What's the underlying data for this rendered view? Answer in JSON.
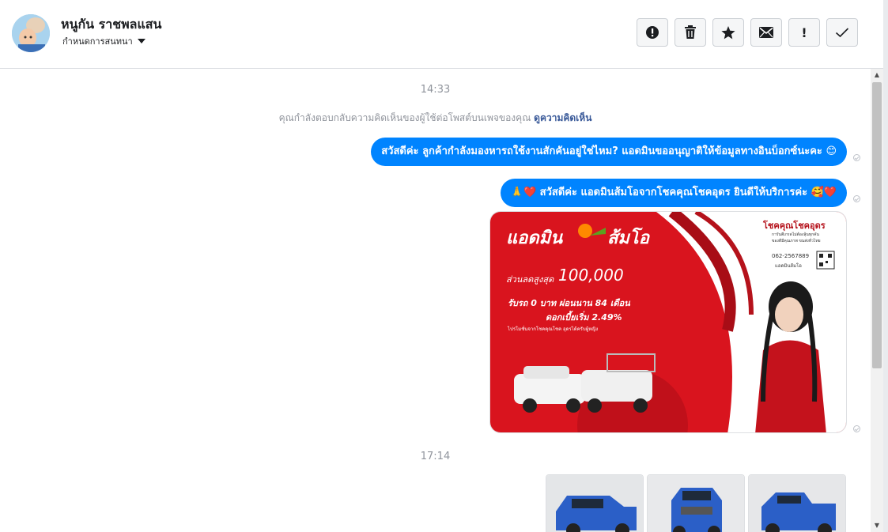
{
  "header": {
    "name": "หนูกัน ราชพลแสน",
    "subtitle": "กำหนดการสนทนา"
  },
  "toolbar": [
    {
      "icon": "exclamation-circle-icon"
    },
    {
      "icon": "trash-icon"
    },
    {
      "icon": "star-icon"
    },
    {
      "icon": "envelope-icon"
    },
    {
      "icon": "exclamation-icon",
      "glyph": "!"
    },
    {
      "icon": "check-icon"
    }
  ],
  "conversation": {
    "timestamp1": "14:33",
    "notice_text": "คุณกำลังตอบกลับความคิดเห็นของผู้ใช้ต่อโพสต์บนเพจของคุณ",
    "notice_link": "ดูความคิดเห็น",
    "messages": [
      {
        "text": "สวัสดีค่ะ ลูกค้ากำลังมองหารถใช้งานสักคันอยู่ใช่ไหม? แอดมินขออนุญาติให้ข้อมูลทางอินบ็อกซ์นะคะ 😊"
      },
      {
        "text": "🙏❤️ สวัสดีค่ะ แอดมินส้มโอจากโชคคุณโชคอุดร ยินดีให้บริการค่ะ 🥰❤️"
      }
    ],
    "ad_image": {
      "headline": "แอดมิน",
      "headline2": "ส้มโอ",
      "discount_label": "ส่วนลดสูงสุด",
      "discount_value": "100,000",
      "line2": "รับรถ 0 บาท ผ่อนนาน 84 เดือน",
      "line3": "ดอกเบี้ยเริ่ม 2.49%",
      "small_note": "ไปรโมชั่นจากโชคคุณโชค อุดรได้ครับผู้หญิง",
      "brand": "โชคคุณโชคอุดร",
      "brand_sub": "การันตีเกรดไม่ต้องลุ้นทุกคัน",
      "brand_sub2": "ของดีมีคุณภาพ ขนส่งทั่วไทย",
      "phone": "062-2567889",
      "line_id": "แอดมินส้มโอ"
    },
    "timestamp2": "17:14"
  },
  "colors": {
    "bubble": "#0084ff",
    "link": "#385898",
    "ad_red": "#d9141e"
  }
}
